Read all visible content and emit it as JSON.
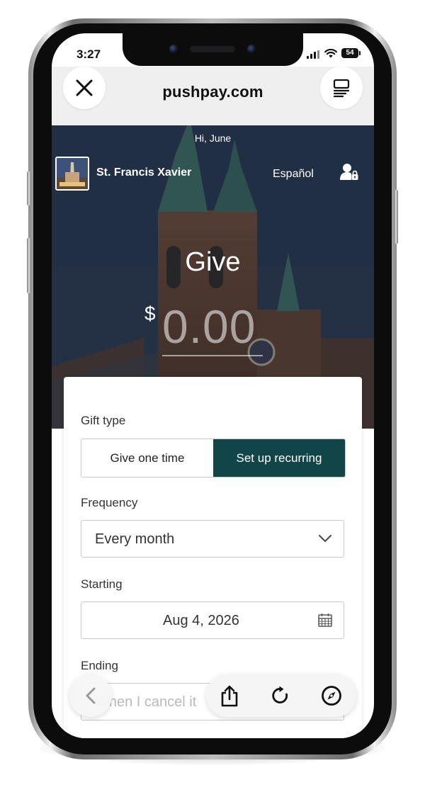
{
  "status_bar": {
    "time": "3:27",
    "battery": "54"
  },
  "browser": {
    "url": "pushpay.com"
  },
  "hero": {
    "greeting": "Hi, June",
    "org_name": "St. Francis Xavier",
    "language_link": "Español",
    "title": "Give",
    "currency_symbol": "$",
    "amount": "0.00"
  },
  "form": {
    "gift_type": {
      "label": "Gift type",
      "options": [
        "Give one time",
        "Set up recurring"
      ],
      "selected": "Set up recurring"
    },
    "frequency": {
      "label": "Frequency",
      "value": "Every month"
    },
    "starting": {
      "label": "Starting",
      "value": "Aug 4, 2026"
    },
    "ending": {
      "label": "Ending",
      "value": "When I cancel it"
    }
  },
  "colors": {
    "accent": "#124548",
    "page_bg": "#efefef"
  },
  "icons": [
    "close-icon",
    "reader-icon",
    "account-lock-icon",
    "chevron-down-icon",
    "calendar-icon",
    "back-icon",
    "share-icon",
    "reload-icon",
    "compass-icon"
  ]
}
